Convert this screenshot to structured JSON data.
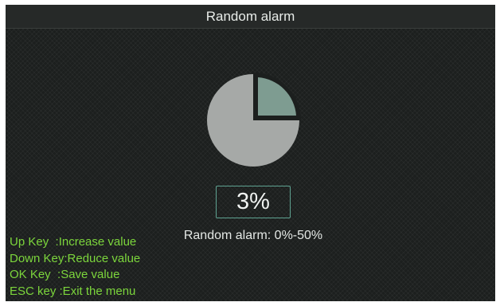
{
  "title": "Random alarm",
  "value": {
    "text": "3%",
    "percent": 3
  },
  "chart": {
    "range_min": 0,
    "range_max": 50,
    "indicator_fraction": 0.25
  },
  "range_text": "Random alarm: 0%-50%",
  "help": [
    "Up Key  :Increase value",
    "Down Key:Reduce value",
    "OK Key  :Save value",
    "ESC key :Exit the menu"
  ],
  "colors": {
    "pie_base": "#a6a9a7",
    "pie_slice": "#7e9c91",
    "accent": "#5fa392",
    "help_text": "#7cd63c"
  }
}
